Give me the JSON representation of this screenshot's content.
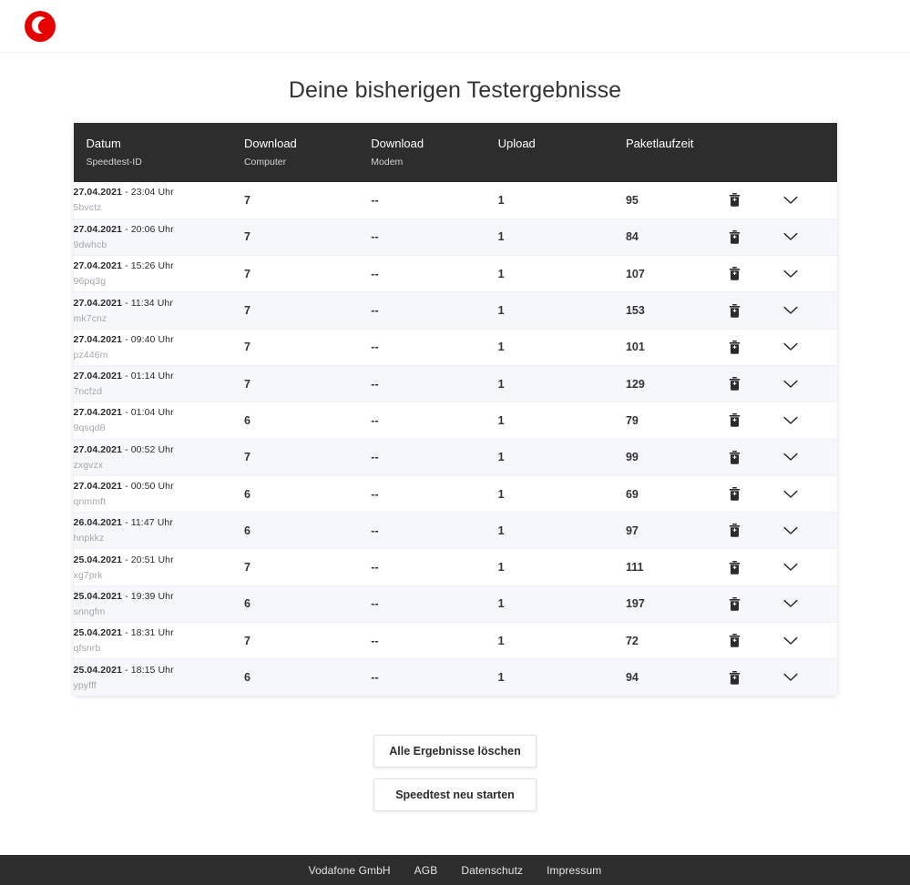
{
  "brand": {
    "logo_name": "vodafone-logo",
    "logo_color": "#e60000"
  },
  "page": {
    "title": "Deine bisherigen Testergebnisse"
  },
  "table": {
    "columns": [
      {
        "main": "Datum",
        "sub": "Speedtest-ID"
      },
      {
        "main": "Download",
        "sub": "Computer"
      },
      {
        "main": "Download",
        "sub": "Modem"
      },
      {
        "main": "Upload",
        "sub": ""
      },
      {
        "main": "Paketlaufzeit",
        "sub": ""
      }
    ],
    "row_icons": {
      "delete": "trash-icon",
      "expand": "chevron-down-icon"
    },
    "rows": [
      {
        "date": "27.04.2021",
        "sep": "-",
        "time": "23:04 Uhr",
        "id": "5bvctz",
        "download_computer": "7",
        "download_modem": "--",
        "upload": "1",
        "paketlaufzeit": "95"
      },
      {
        "date": "27.04.2021",
        "sep": "-",
        "time": "20:06 Uhr",
        "id": "9dwhcb",
        "download_computer": "7",
        "download_modem": "--",
        "upload": "1",
        "paketlaufzeit": "84"
      },
      {
        "date": "27.04.2021",
        "sep": "-",
        "time": "15:26 Uhr",
        "id": "96pq3g",
        "download_computer": "7",
        "download_modem": "--",
        "upload": "1",
        "paketlaufzeit": "107"
      },
      {
        "date": "27.04.2021",
        "sep": "-",
        "time": "11:34 Uhr",
        "id": "mk7cnz",
        "download_computer": "7",
        "download_modem": "--",
        "upload": "1",
        "paketlaufzeit": "153"
      },
      {
        "date": "27.04.2021",
        "sep": "-",
        "time": "09:40 Uhr",
        "id": "pz446m",
        "download_computer": "7",
        "download_modem": "--",
        "upload": "1",
        "paketlaufzeit": "101"
      },
      {
        "date": "27.04.2021",
        "sep": "-",
        "time": "01:14 Uhr",
        "id": "7ncfzd",
        "download_computer": "7",
        "download_modem": "--",
        "upload": "1",
        "paketlaufzeit": "129"
      },
      {
        "date": "27.04.2021",
        "sep": "-",
        "time": "01:04 Uhr",
        "id": "9qsqd8",
        "download_computer": "6",
        "download_modem": "--",
        "upload": "1",
        "paketlaufzeit": "79"
      },
      {
        "date": "27.04.2021",
        "sep": "-",
        "time": "00:52 Uhr",
        "id": "zxgvzx",
        "download_computer": "7",
        "download_modem": "--",
        "upload": "1",
        "paketlaufzeit": "99"
      },
      {
        "date": "27.04.2021",
        "sep": "-",
        "time": "00:50 Uhr",
        "id": "qnmmft",
        "download_computer": "6",
        "download_modem": "--",
        "upload": "1",
        "paketlaufzeit": "69"
      },
      {
        "date": "26.04.2021",
        "sep": "-",
        "time": "11:47 Uhr",
        "id": "hnpkkz",
        "download_computer": "6",
        "download_modem": "--",
        "upload": "1",
        "paketlaufzeit": "97"
      },
      {
        "date": "25.04.2021",
        "sep": "-",
        "time": "20:51 Uhr",
        "id": "xg7prk",
        "download_computer": "7",
        "download_modem": "--",
        "upload": "1",
        "paketlaufzeit": "111"
      },
      {
        "date": "25.04.2021",
        "sep": "-",
        "time": "19:39 Uhr",
        "id": "snngfm",
        "download_computer": "6",
        "download_modem": "--",
        "upload": "1",
        "paketlaufzeit": "197"
      },
      {
        "date": "25.04.2021",
        "sep": "-",
        "time": "18:31 Uhr",
        "id": "qfsnrb",
        "download_computer": "7",
        "download_modem": "--",
        "upload": "1",
        "paketlaufzeit": "72"
      },
      {
        "date": "25.04.2021",
        "sep": "-",
        "time": "18:15 Uhr",
        "id": "ypyfff",
        "download_computer": "6",
        "download_modem": "--",
        "upload": "1",
        "paketlaufzeit": "94"
      }
    ]
  },
  "actions": {
    "delete_all_label": "Alle Ergebnisse löschen",
    "restart_label": "Speedtest neu starten"
  },
  "footer": {
    "links": [
      {
        "label": "Vodafone GmbH"
      },
      {
        "label": "AGB"
      },
      {
        "label": "Datenschutz"
      },
      {
        "label": "Impressum"
      }
    ]
  }
}
